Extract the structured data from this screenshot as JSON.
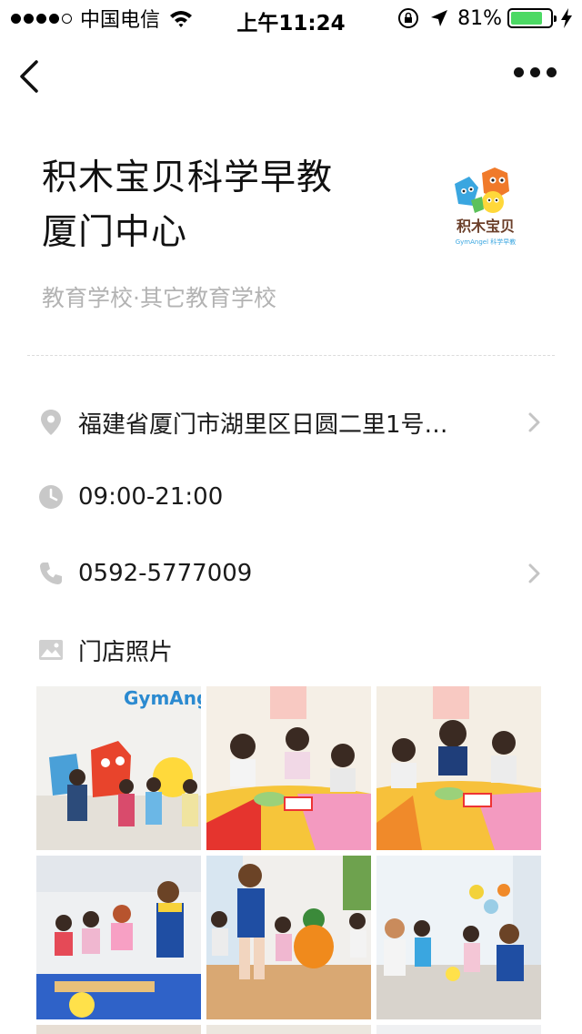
{
  "status_bar": {
    "carrier": "中国电信",
    "time": "上午11:24",
    "battery_percent": "81%",
    "battery_level": 0.81,
    "battery_color": "#4cd964"
  },
  "nav": {
    "back_icon": "chevron-left-icon",
    "more_icon": "more-dots-icon"
  },
  "header": {
    "title_line1": "积木宝贝科学早教",
    "title_line2": "厦门中心",
    "category": "教育学校·其它教育学校",
    "logo_text": "积木宝贝",
    "logo_subtext": "GymAngel 科学早教"
  },
  "info": {
    "address": "福建省厦门市湖里区日圆二里1号…",
    "hours": "09:00-21:00",
    "phone": "0592-5777009",
    "photos_label": "门店照片"
  },
  "photos": {
    "count_visible": 6,
    "brand_text": "GymAng"
  }
}
